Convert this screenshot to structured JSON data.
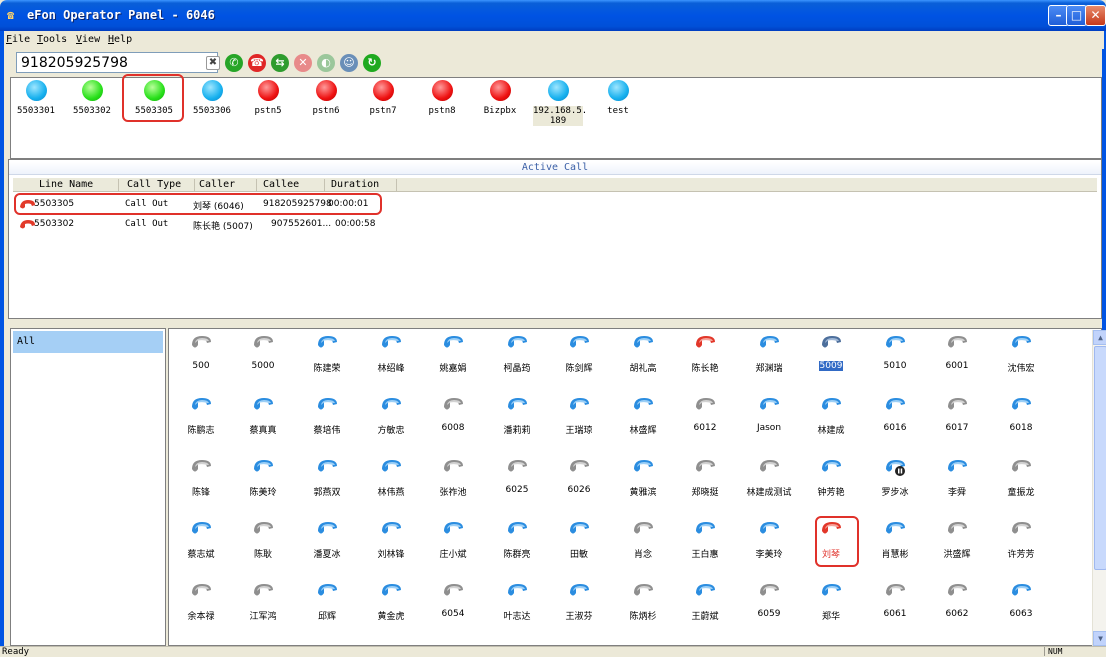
{
  "window": {
    "title": "eFon Operator Panel - 6046",
    "app_icon": "phone-people-icon"
  },
  "menu": [
    "File",
    "Tools",
    "View",
    "Help"
  ],
  "toolbar": {
    "dial_value": "918205925798",
    "buttons": [
      {
        "name": "clear-icon",
        "glyph": "✖"
      },
      {
        "name": "call-icon",
        "glyph": "✆"
      },
      {
        "name": "hangup-icon",
        "glyph": "☎"
      },
      {
        "name": "transfer-icon",
        "glyph": "⇆"
      },
      {
        "name": "cancel-icon",
        "glyph": "✕"
      },
      {
        "name": "hold-icon",
        "glyph": "◐"
      },
      {
        "name": "contacts-icon",
        "glyph": "☺"
      },
      {
        "name": "refresh-icon",
        "glyph": "↻"
      }
    ]
  },
  "lines": [
    {
      "label": "5503301",
      "status": "blue"
    },
    {
      "label": "5503302",
      "status": "green"
    },
    {
      "label": "5503305",
      "status": "green"
    },
    {
      "label": "5503306",
      "status": "blue"
    },
    {
      "label": "pstn5",
      "status": "red"
    },
    {
      "label": "pstn6",
      "status": "red"
    },
    {
      "label": "pstn7",
      "status": "red"
    },
    {
      "label": "pstn8",
      "status": "red"
    },
    {
      "label": "Bizpbx",
      "status": "red"
    },
    {
      "label": "192.168.5.\n189",
      "status": "blue"
    },
    {
      "label": "test",
      "status": "blue"
    }
  ],
  "active_call": {
    "title": "Active Call",
    "columns": [
      "Line Name",
      "Call Type",
      "Caller",
      "Callee",
      "Duration"
    ],
    "rows": [
      {
        "line": "5503305",
        "type": "Call Out",
        "caller": "刘琴 (6046)",
        "callee": "918205925798",
        "duration": "00:00:01"
      },
      {
        "line": "5503302",
        "type": "Call Out",
        "caller": "陈长艳 (5007)",
        "callee": "907552601...",
        "duration": "00:00:58"
      }
    ]
  },
  "groups": [
    "All"
  ],
  "extensions": [
    [
      "500",
      "5000",
      "陈建荣",
      "林绍峰",
      "姚嘉娟",
      "柯晶筠",
      "陈剑辉",
      "胡礼高",
      "陈长艳",
      "郑渊瑞",
      "5009",
      "5010",
      "6001",
      "沈伟宏"
    ],
    [
      "陈鹏志",
      "蔡真真",
      "蔡培伟",
      "方敏忠",
      "6008",
      "潘莉莉",
      "王瑞琼",
      "林盛辉",
      "6012",
      "Jason",
      "林建成",
      "6016",
      "6017",
      "6018"
    ],
    [
      "陈锋",
      "陈美玲",
      "郭燕双",
      "林伟燕",
      "张祚池",
      "6025",
      "6026",
      "黄雅滨",
      "郑晓挺",
      "林建成测试",
      "钟芳艳",
      "罗步冰",
      "李舜",
      "童振龙"
    ],
    [
      "蔡志斌",
      "陈耿",
      "潘夏冰",
      "刘林锋",
      "庄小斌",
      "陈群亮",
      "田敏",
      "肖念",
      "王白惠",
      "李美玲",
      "刘琴",
      "肖慧彬",
      "洪盛辉",
      "许芳芳"
    ],
    [
      "余本禄",
      "江军鸿",
      "邱辉",
      "黄金虎",
      "6054",
      "叶志达",
      "王淑芬",
      "陈炳杉",
      "王蔚斌",
      "6059",
      "郑华",
      "6061",
      "6062",
      "6063"
    ]
  ],
  "extension_status": [
    [
      "gray",
      "gray",
      "blue",
      "blue",
      "blue",
      "blue",
      "blue",
      "blue",
      "red",
      "blue",
      "dark",
      "blue",
      "gray",
      "blue"
    ],
    [
      "blue",
      "blue",
      "blue",
      "blue",
      "gray",
      "blue",
      "blue",
      "blue",
      "gray",
      "blue",
      "blue",
      "blue",
      "gray",
      "blue"
    ],
    [
      "gray",
      "blue",
      "blue",
      "blue",
      "gray",
      "gray",
      "gray",
      "blue",
      "gray",
      "gray",
      "blue",
      "hold",
      "blue",
      "gray"
    ],
    [
      "blue",
      "gray",
      "blue",
      "blue",
      "blue",
      "blue",
      "blue",
      "gray",
      "blue",
      "blue",
      "red",
      "blue",
      "gray",
      "gray"
    ],
    [
      "gray",
      "gray",
      "blue",
      "blue",
      "gray",
      "blue",
      "blue",
      "gray",
      "blue",
      "gray",
      "blue",
      "gray",
      "gray",
      "blue"
    ]
  ],
  "status_bar": {
    "text": "Ready",
    "num": "NUM"
  }
}
